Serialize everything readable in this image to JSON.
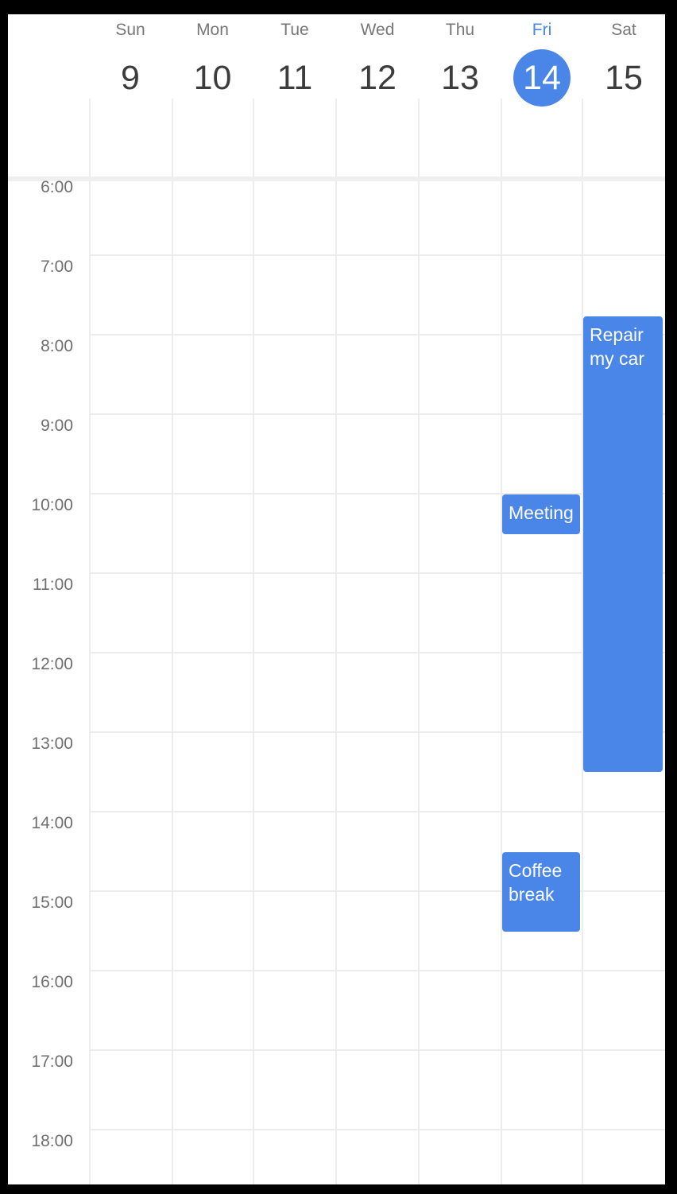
{
  "week": {
    "days": [
      {
        "name": "Sun",
        "number": "9"
      },
      {
        "name": "Mon",
        "number": "10"
      },
      {
        "name": "Tue",
        "number": "11"
      },
      {
        "name": "Wed",
        "number": "12"
      },
      {
        "name": "Thu",
        "number": "13"
      },
      {
        "name": "Fri",
        "number": "14",
        "today": true
      },
      {
        "name": "Sat",
        "number": "15"
      }
    ]
  },
  "times": [
    "6:00",
    "7:00",
    "8:00",
    "9:00",
    "10:00",
    "11:00",
    "12:00",
    "13:00",
    "14:00",
    "15:00",
    "16:00",
    "17:00",
    "18:00"
  ],
  "events": [
    {
      "title": "Repair my car",
      "day": "Sat",
      "start": "7:45",
      "end": "13:30"
    },
    {
      "title": "Meeting",
      "day": "Fri",
      "start": "10:00",
      "end": "10:30"
    },
    {
      "title": "Coffee break",
      "day": "Fri",
      "start": "14:30",
      "end": "15:30"
    }
  ],
  "colors": {
    "accent": "#4a86e8",
    "grid": "#ececec",
    "text_muted": "#777777"
  }
}
